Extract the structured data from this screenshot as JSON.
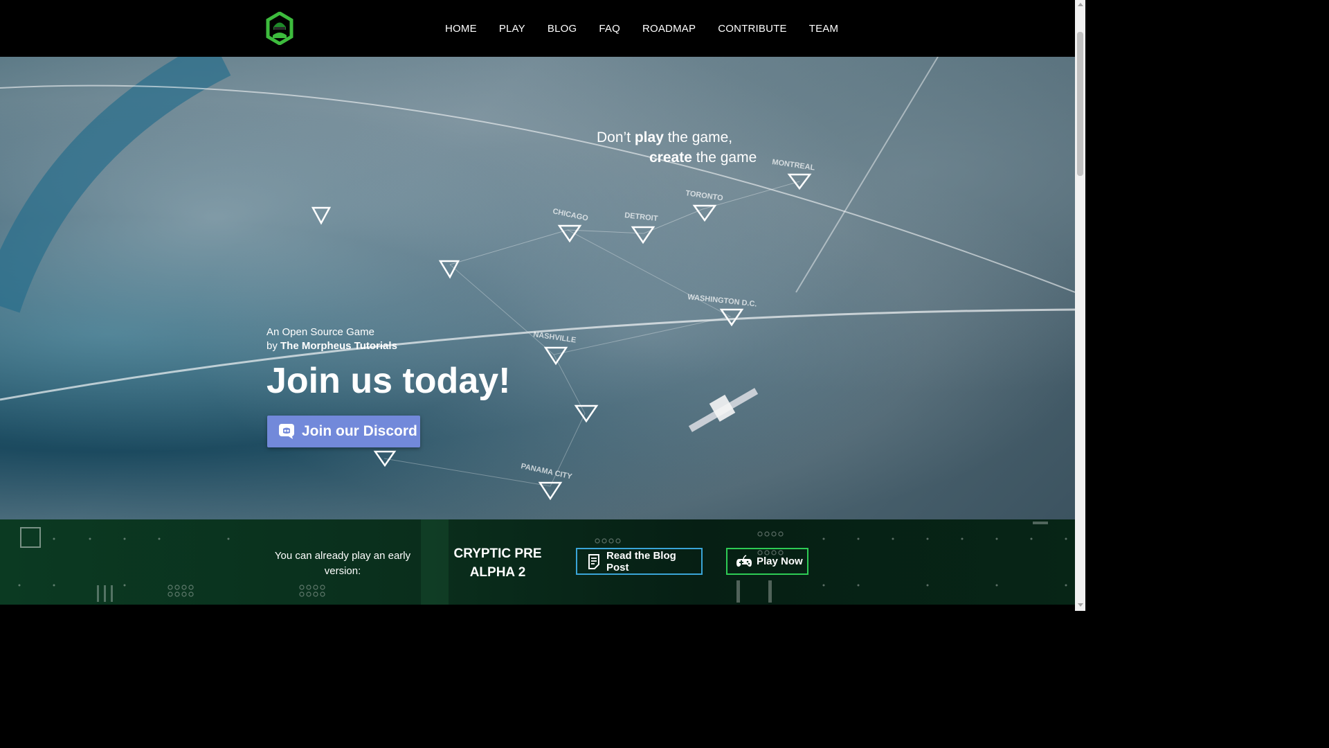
{
  "nav": {
    "items": [
      "HOME",
      "PLAY",
      "BLOG",
      "FAQ",
      "ROADMAP",
      "CONTRIBUTE",
      "TEAM"
    ]
  },
  "hero": {
    "tagline": {
      "l1_a": "Don’t ",
      "l1_b": "play",
      "l1_c": " the game,",
      "l2_a": "create",
      "l2_b": " the game"
    },
    "byline_1": "An Open Source Game",
    "byline_2_pre": "by ",
    "byline_2_name": "The Morpheus Tutorials",
    "headline": "Join us today!",
    "discord_label": "Join our Discord"
  },
  "map_labels": [
    "MONTREAL",
    "TORONTO",
    "CHICAGO",
    "DETROIT",
    "WASHINGTON D.C.",
    "NASHVILLE",
    "PANAMA CITY"
  ],
  "band": {
    "text": "You can already play an early version:",
    "release": "CRYPTIC PRE ALPHA 2",
    "blog_label": "Read the Blog Post",
    "play_label": "Play Now"
  },
  "colors": {
    "discord": "#7289da",
    "blog_border": "#3aa5d8",
    "play_border": "#2ecc55",
    "logo_green": "#3dbb3d"
  },
  "icons": {
    "logo": "hooded-hacker-hexagon-logo",
    "discord": "discord-icon",
    "blog": "document-icon",
    "play": "gamepad-icon"
  }
}
